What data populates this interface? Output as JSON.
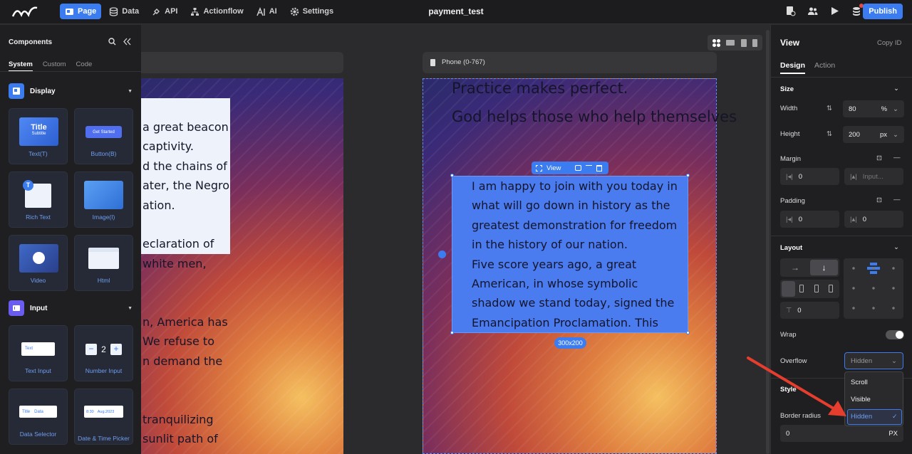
{
  "nav": [
    {
      "label": "Page",
      "icon": "page-icon",
      "active": true
    },
    {
      "label": "Data",
      "icon": "data-icon",
      "active": false
    },
    {
      "label": "API",
      "icon": "api-icon",
      "active": false
    },
    {
      "label": "Actionflow",
      "icon": "actionflow-icon",
      "active": false
    },
    {
      "label": "AI",
      "icon": "ai-icon",
      "active": false
    },
    {
      "label": "Settings",
      "icon": "gear-icon",
      "active": false
    }
  ],
  "doc_title": "payment_test",
  "publish_label": "Publish",
  "left_panel": {
    "title": "Components",
    "tabs": [
      "System",
      "Custom",
      "Code"
    ],
    "active_tab": "System",
    "categories": [
      {
        "label": "Display"
      },
      {
        "label": "Input"
      }
    ],
    "display_cards": [
      "Text(T)",
      "Button(B)",
      "Rich Text",
      "Image(I)",
      "Video",
      "Html"
    ],
    "input_cards": [
      "Text Input",
      "Number Input",
      "Data Selector",
      "Date & Time Picker"
    ],
    "title_card": {
      "title": "Title",
      "subtitle": "Subtitle"
    },
    "button_card": "Get Started",
    "text_card": "Text",
    "number_card": "2",
    "data_card": {
      "a": "Title",
      "b": "Data"
    },
    "date_card": {
      "a": "8:30",
      "b": "Aug.2023"
    }
  },
  "canvas": {
    "phone_label": "Phone (0-767)",
    "big_lines": [
      "Practice makes perfect.",
      "God helps those who help themselves"
    ],
    "view_text": [
      "I am happy to join with you today in",
      "what will go down in history as the",
      "greatest demonstration for freedom",
      "in the history of our nation.",
      "Five score years ago, a great",
      "American, in whose symbolic",
      "shadow we stand today, signed the",
      "Emancipation Proclamation. This"
    ],
    "left_lines": [
      "a great beacon",
      "captivity.",
      "d the chains of",
      "ater, the Negro",
      "ation.",
      "",
      "eclaration of",
      "white men,",
      "",
      "",
      "n, America has",
      "We refuse to",
      "n demand the",
      "",
      "",
      "tranquilizing",
      "sunlit path of"
    ],
    "viewbar_label": "View",
    "size_tag": "300x200"
  },
  "right_panel": {
    "title": "View",
    "copy_id": "Copy ID",
    "tabs": [
      "Design",
      "Action"
    ],
    "size_title": "Size",
    "width_label": "Width",
    "width_value": "80",
    "width_unit": "%",
    "height_label": "Height",
    "height_value": "200",
    "height_unit": "px",
    "margin_label": "Margin",
    "margin_left": "0",
    "margin_right_placeholder": "Input...",
    "padding_label": "Padding",
    "padding_left": "0",
    "padding_right": "0",
    "layout_title": "Layout",
    "gap_value": "0",
    "wrap_label": "Wrap",
    "overflow_label": "Overflow",
    "overflow_value": "Hidden",
    "style_title": "Style",
    "border_radius_label": "Border radius",
    "border_radius_value": "0",
    "border_radius_unit": "PX",
    "overflow_options": [
      "Scroll",
      "Visible",
      "Hidden"
    ],
    "overflow_selected": "Hidden"
  },
  "colors": {
    "accent": "#3b7cf0",
    "annotation": "#e53e2e"
  }
}
